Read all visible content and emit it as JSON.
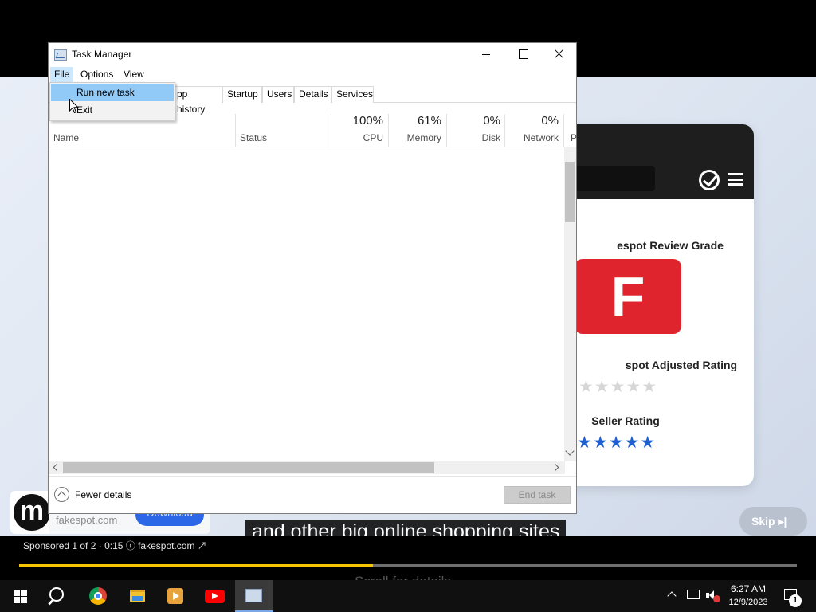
{
  "task_manager": {
    "title": "Task Manager",
    "menu": [
      "File",
      "Options",
      "View"
    ],
    "file_menu": {
      "run_new_task": "Run new task",
      "exit": "Exit"
    },
    "tabs": [
      "pp history",
      "Startup",
      "Users",
      "Details",
      "Services"
    ],
    "columns": {
      "name": "Name",
      "status": "Status",
      "cpu": {
        "label": "CPU",
        "value": "100%"
      },
      "memory": {
        "label": "Memory",
        "value": "61%"
      },
      "disk": {
        "label": "Disk",
        "value": "0%"
      },
      "network": {
        "label": "Network",
        "value": "0%"
      },
      "partial": "P"
    },
    "footer": {
      "fewer_details": "Fewer details",
      "end_task": "End task"
    }
  },
  "ad": {
    "card": {
      "grade_title": "espot Review Grade",
      "grade": "F",
      "adjusted_title": "spot Adjusted Rating",
      "adjusted_rating": "★★★★★",
      "seller_title": "Seller Rating",
      "seller_rating": "★★★★★"
    },
    "logo_letter": "m",
    "domain": "fakespot.com",
    "download": "Download",
    "skip": "Skip ▸|",
    "caption": "and other big online shopping sites",
    "sponsored": "Sponsored 1 of 2 · 0:15  ⓘ   fakespot.com ↗",
    "progress": 0.455,
    "scroll_hint": "Scroll for details",
    "colors": {
      "grade_red": "#e0242d",
      "star_blue": "#1f5fcf",
      "progress_yellow": "#f6c400"
    }
  },
  "taskbar": {
    "time": "6:27 AM",
    "date": "12/9/2023",
    "notifications": "1"
  }
}
